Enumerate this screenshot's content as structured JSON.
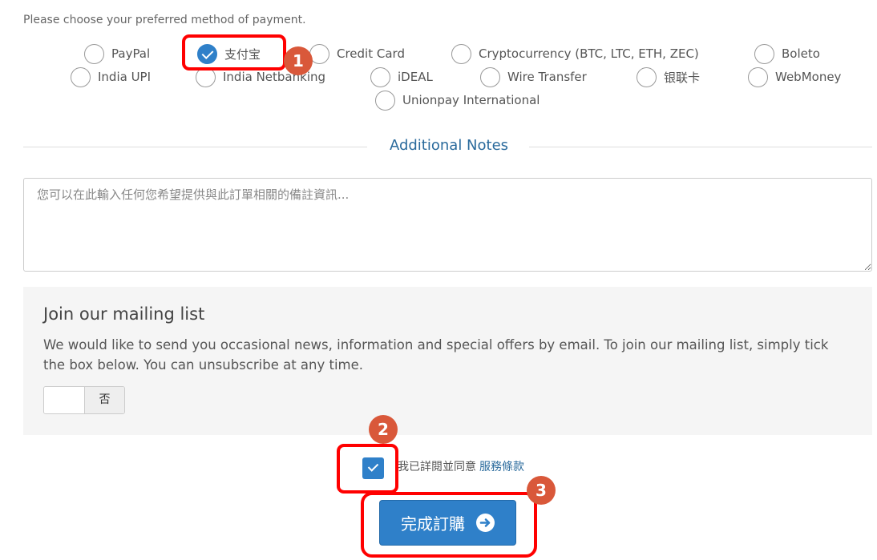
{
  "intro": "Please choose your preferred method of payment.",
  "payment_methods": [
    {
      "label": "PayPal",
      "checked": false
    },
    {
      "label": "支付宝",
      "checked": true
    },
    {
      "label": "Credit Card",
      "checked": false
    },
    {
      "label": "Cryptocurrency (BTC, LTC, ETH, ZEC)",
      "checked": false
    },
    {
      "label": "Boleto",
      "checked": false
    },
    {
      "label": "India UPI",
      "checked": false
    },
    {
      "label": "India Netbanking",
      "checked": false
    },
    {
      "label": "iDEAL",
      "checked": false
    },
    {
      "label": "Wire Transfer",
      "checked": false
    },
    {
      "label": "银联卡",
      "checked": false
    },
    {
      "label": "WebMoney",
      "checked": false
    },
    {
      "label": "Unionpay International",
      "checked": false
    }
  ],
  "notes": {
    "title": "Additional Notes",
    "placeholder": "您可以在此輸入任何您希望提供與此訂單相關的備註資訊..."
  },
  "mailing": {
    "title": "Join our mailing list",
    "text": "We would like to send you occasional news, information and special offers by email. To join our mailing list, simply tick the box below. You can unsubscribe at any time.",
    "toggle_label": "否"
  },
  "terms": {
    "text": "我已詳閱並同意",
    "link": "服務條款",
    "checked": true
  },
  "submit": {
    "label": "完成訂購"
  },
  "badges": [
    "1",
    "2",
    "3"
  ],
  "colors": {
    "accent": "#2f80c9",
    "highlight": "#ff0000",
    "badge": "#d9583a"
  }
}
